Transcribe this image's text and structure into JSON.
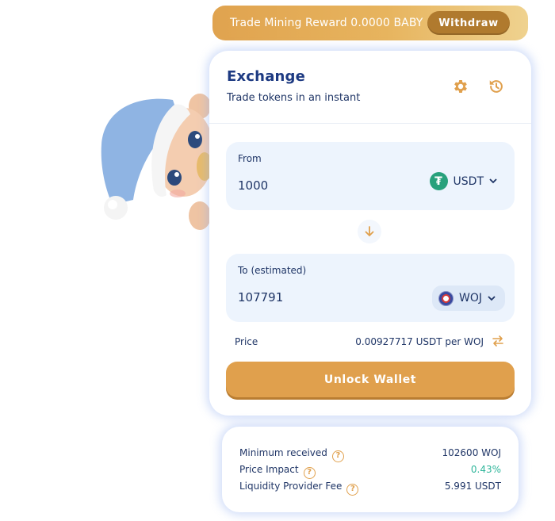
{
  "reward_banner": {
    "text": "Trade Mining Reward 0.0000 BABY",
    "withdraw_label": "Withdraw"
  },
  "exchange": {
    "title": "Exchange",
    "subtitle": "Trade tokens in an instant",
    "settings_icon": "gear-icon",
    "history_icon": "history-icon",
    "from": {
      "label": "From",
      "amount": "1000",
      "token": "USDT"
    },
    "to": {
      "label": "To (estimated)",
      "amount": "107791",
      "token": "WOJ"
    },
    "price": {
      "label": "Price",
      "value": "0.00927717 USDT per WOJ"
    },
    "unlock_label": "Unlock Wallet"
  },
  "details": [
    {
      "label": "Minimum received",
      "value": "102600 WOJ"
    },
    {
      "label": "Price Impact",
      "value": "0.43%"
    },
    {
      "label": "Liquidity Provider Fee",
      "value": "5.991 USDT"
    }
  ],
  "colors": {
    "accent": "#e0a04d",
    "navy": "#1d3a82",
    "panel_bg": "#edf4fd",
    "positive": "#2eb59a",
    "usdt": "#28a17c"
  }
}
